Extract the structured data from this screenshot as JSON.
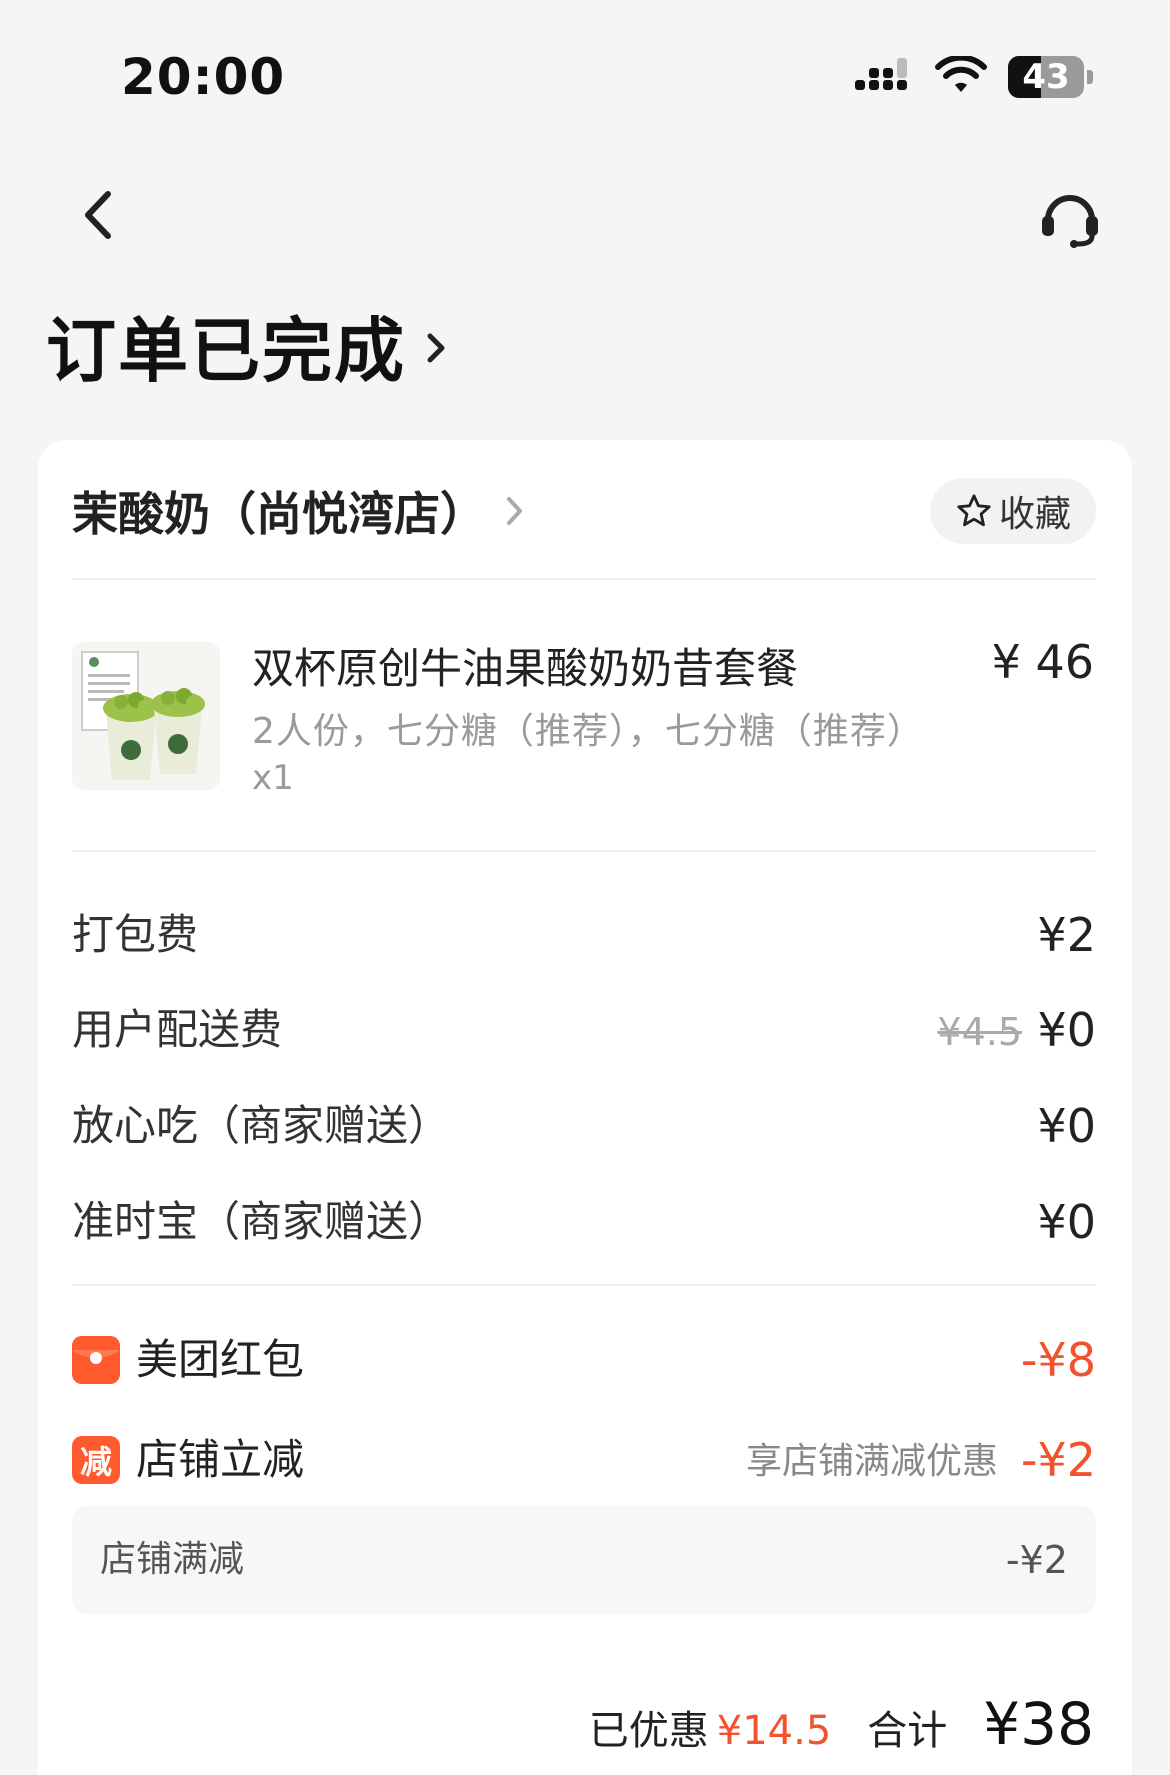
{
  "status_bar": {
    "time": "20:00",
    "battery_level": "43",
    "battery_fraction": 0.43,
    "icons": [
      "signal-icon",
      "wifi-icon",
      "battery-icon"
    ]
  },
  "nav": {
    "back_icon": "chevron-left-icon",
    "support_icon": "headset-icon"
  },
  "order": {
    "status_title": "订单已完成"
  },
  "store": {
    "name": "茉酸奶（尚悦湾店）",
    "favorite_label": "收藏",
    "favorite_icon": "star-outline-icon"
  },
  "product": {
    "name": "双杯原创牛油果酸奶奶昔套餐",
    "price": "¥ 46",
    "specs": "2人份，七分糖（推荐），七分糖（推荐）",
    "quantity": "x1"
  },
  "fees": [
    {
      "label": "打包费",
      "value": "¥2"
    },
    {
      "label": "用户配送费",
      "original": "¥4.5",
      "value": "¥0"
    },
    {
      "label": "放心吃（商家赠送）",
      "value": "¥0"
    },
    {
      "label": "准时宝（商家赠送）",
      "value": "¥0"
    }
  ],
  "discounts": [
    {
      "label": "美团红包",
      "value": "-¥8",
      "icon": "red-packet-icon"
    },
    {
      "label": "店铺立减",
      "value": "-¥2",
      "note": "享店铺满减优惠",
      "icon_text": "减"
    }
  ],
  "discount_detail": {
    "label": "店铺满减",
    "value": "-¥2"
  },
  "summary": {
    "saved_label": "已优惠",
    "saved_value": "¥14.5",
    "total_label": "合计",
    "total_value": "¥38"
  },
  "colors": {
    "accent_red": "#f2522d",
    "background": "#f5f5f5",
    "card": "#ffffff"
  }
}
